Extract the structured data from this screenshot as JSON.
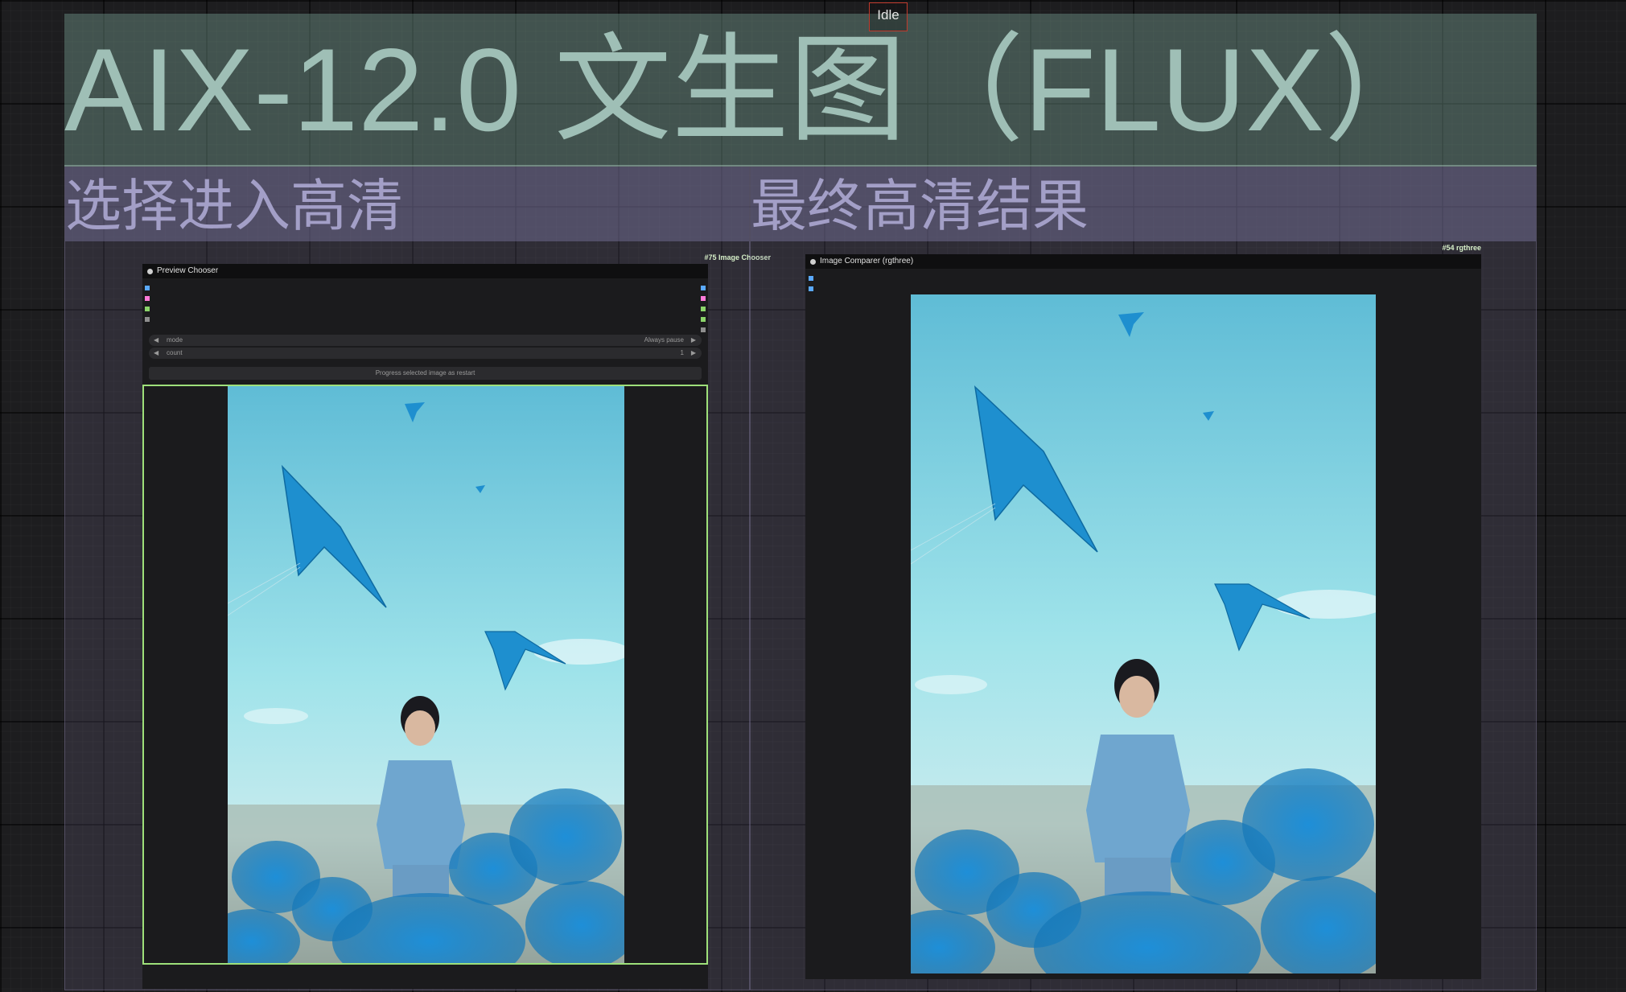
{
  "status": "Idle",
  "title": "AIX-12.0 文生图（FLUX）",
  "groups": {
    "select": {
      "title": "选择进入高清"
    },
    "final": {
      "title": "最终高清结果"
    }
  },
  "preview_chooser": {
    "tag": "#75 Image Chooser",
    "title": "Preview Chooser",
    "widgets": [
      {
        "name": "mode",
        "value": "Always pause"
      },
      {
        "name": "count",
        "value": "1"
      }
    ],
    "button": "Progress selected image as restart",
    "input_slot_colors": [
      "#5aa9ff",
      "#ff7ad9",
      "#8bd46a",
      "#8e8e8e"
    ],
    "output_slot_colors": [
      "#5aa9ff",
      "#ff7ad9",
      "#8bd46a",
      "#8bd46a",
      "#8e8e8e"
    ]
  },
  "image_comparer": {
    "tag": "#54 rgthree",
    "title": "Image Comparer (rgthree)",
    "input_slot_colors": [
      "#5aa9ff",
      "#5aa9ff"
    ]
  },
  "icons": {
    "left_arrow": "◀",
    "right_arrow": "▶"
  },
  "colors": {
    "title_group": "#4a5e58",
    "title_text": "#9fbfb6",
    "section_group": "#4a4660",
    "section_text": "#a39fc7",
    "selection_border": "#9ee07a",
    "status_border": "#c0392b"
  }
}
